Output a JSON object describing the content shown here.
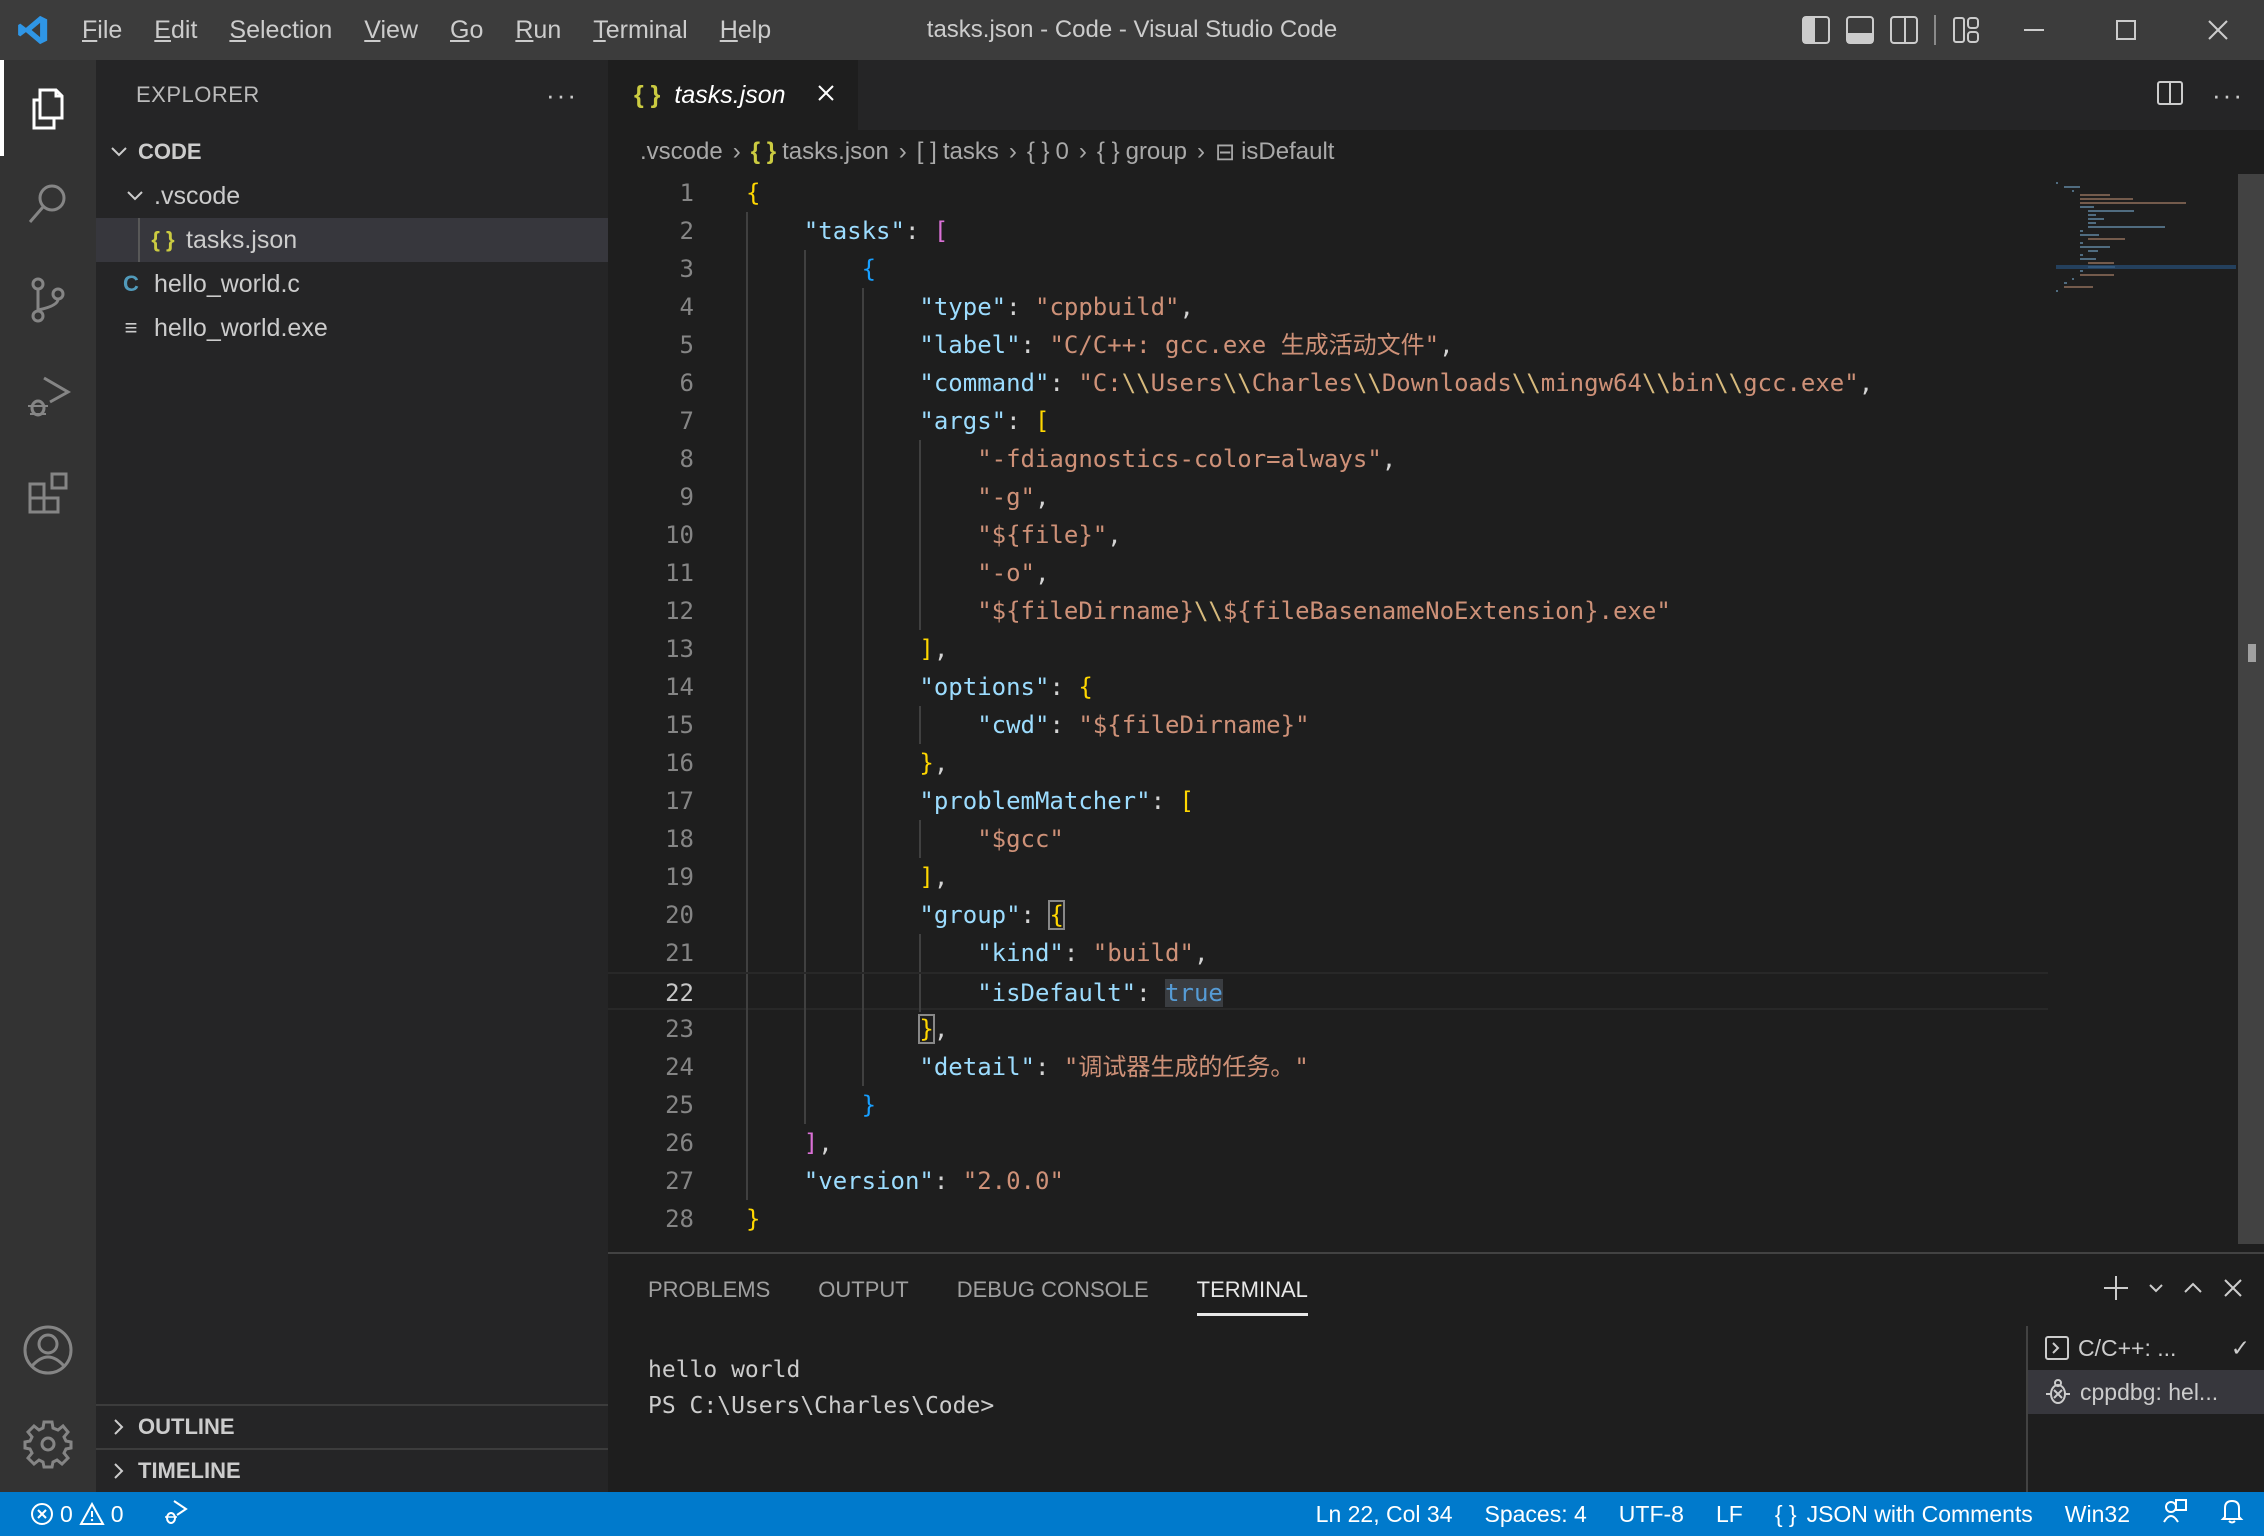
{
  "window": {
    "title": "tasks.json - Code - Visual Studio Code",
    "menu": [
      {
        "label": "File",
        "mnemonic": "F",
        "rest": "ile"
      },
      {
        "label": "Edit",
        "mnemonic": "E",
        "rest": "dit"
      },
      {
        "label": "Selection",
        "mnemonic": "S",
        "rest": "election"
      },
      {
        "label": "View",
        "mnemonic": "V",
        "rest": "iew"
      },
      {
        "label": "Go",
        "mnemonic": "G",
        "rest": "o"
      },
      {
        "label": "Run",
        "mnemonic": "R",
        "rest": "un"
      },
      {
        "label": "Terminal",
        "mnemonic": "T",
        "rest": "erminal"
      },
      {
        "label": "Help",
        "mnemonic": "H",
        "rest": "elp"
      }
    ]
  },
  "activity_bar": {
    "items": [
      "explorer",
      "search",
      "source-control",
      "run-and-debug",
      "extensions"
    ],
    "active": "explorer",
    "bottom": [
      "accounts",
      "manage"
    ]
  },
  "sidebar": {
    "title": "EXPLORER",
    "more": "···",
    "root": "CODE",
    "tree": [
      {
        "name": ".vscode",
        "type": "folder",
        "expanded": true
      },
      {
        "name": "tasks.json",
        "type": "json",
        "icon": "{ }",
        "selected": true
      },
      {
        "name": "hello_world.c",
        "type": "c",
        "icon": "C"
      },
      {
        "name": "hello_world.exe",
        "type": "binary",
        "icon": "≡"
      }
    ],
    "outline": "OUTLINE",
    "timeline": "TIMELINE"
  },
  "editor": {
    "tab": {
      "icon": "{ }",
      "label": "tasks.json",
      "close": "✕"
    },
    "breadcrumb": [
      {
        "label": ".vscode",
        "icon": ""
      },
      {
        "label": "tasks.json",
        "icon": "{ }"
      },
      {
        "label": "tasks",
        "icon": "[ ]"
      },
      {
        "label": "0",
        "icon": "{ }"
      },
      {
        "label": "group",
        "icon": "{ }"
      },
      {
        "label": "isDefault",
        "icon": "⊟"
      }
    ],
    "active_line": 22,
    "lines": [
      "{",
      "    \"tasks\": [",
      "        {",
      "            \"type\": \"cppbuild\",",
      "            \"label\": \"C/C++: gcc.exe 生成活动文件\",",
      "            \"command\": \"C:\\\\Users\\\\Charles\\\\Downloads\\\\mingw64\\\\bin\\\\gcc.exe\",",
      "            \"args\": [",
      "                \"-fdiagnostics-color=always\",",
      "                \"-g\",",
      "                \"${file}\",",
      "                \"-o\",",
      "                \"${fileDirname}\\\\${fileBasenameNoExtension}.exe\"",
      "            ],",
      "            \"options\": {",
      "                \"cwd\": \"${fileDirname}\"",
      "            },",
      "            \"problemMatcher\": [",
      "                \"$gcc\"",
      "            ],",
      "            \"group\": {",
      "                \"kind\": \"build\",",
      "                \"isDefault\": true",
      "            },",
      "            \"detail\": \"调试器生成的任务。\"",
      "        }",
      "    ],",
      "    \"version\": \"2.0.0\"",
      "}"
    ]
  },
  "panel": {
    "tabs": [
      "PROBLEMS",
      "OUTPUT",
      "DEBUG CONSOLE",
      "TERMINAL"
    ],
    "active_tab": "TERMINAL",
    "terminal_lines": [
      "hello world",
      "PS C:\\Users\\Charles\\Code>"
    ],
    "terminals": [
      {
        "label": "C/C++: ...",
        "icon": "terminal-icon",
        "status": "✓",
        "active": false
      },
      {
        "label": "cppdbg: hel...",
        "icon": "debug-icon",
        "status": "",
        "active": true
      }
    ]
  },
  "status_bar": {
    "errors": "0",
    "warnings": "0",
    "position": "Ln 22, Col 34",
    "indent": "Spaces: 4",
    "encoding": "UTF-8",
    "eol": "LF",
    "language_icon": "{ }",
    "language": "JSON with Comments",
    "platform": "Win32"
  },
  "colors": {
    "accent": "#007acc",
    "key": "#9cdcfe",
    "string": "#ce9178",
    "escape": "#d7ba7d",
    "bracket1": "#ffd700",
    "bracket2": "#da70d6",
    "bracket3": "#179fff",
    "keyword": "#569cd6"
  }
}
